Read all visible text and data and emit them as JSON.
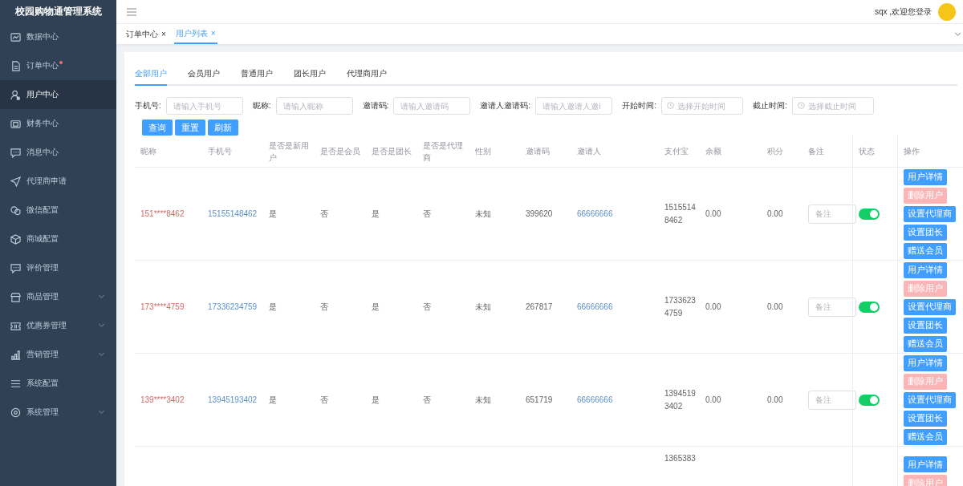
{
  "app": {
    "title": "校园购物通管理系统"
  },
  "sidebar": {
    "items": [
      {
        "label": "数据中心",
        "selected": false,
        "badge": false,
        "expandable": false
      },
      {
        "label": "订单中心",
        "selected": false,
        "badge": true,
        "expandable": false
      },
      {
        "label": "用户中心",
        "selected": true,
        "badge": false,
        "expandable": false
      },
      {
        "label": "财务中心",
        "selected": false,
        "badge": false,
        "expandable": false
      },
      {
        "label": "消息中心",
        "selected": false,
        "badge": false,
        "expandable": false
      },
      {
        "label": "代理商申请",
        "selected": false,
        "badge": false,
        "expandable": false
      },
      {
        "label": "微信配置",
        "selected": false,
        "badge": false,
        "expandable": false
      },
      {
        "label": "商城配置",
        "selected": false,
        "badge": false,
        "expandable": false
      },
      {
        "label": "评价管理",
        "selected": false,
        "badge": false,
        "expandable": false
      },
      {
        "label": "商品管理",
        "selected": false,
        "badge": false,
        "expandable": true
      },
      {
        "label": "优惠券管理",
        "selected": false,
        "badge": false,
        "expandable": true
      },
      {
        "label": "营销管理",
        "selected": false,
        "badge": false,
        "expandable": true
      },
      {
        "label": "系统配置",
        "selected": false,
        "badge": false,
        "expandable": false
      },
      {
        "label": "系统管理",
        "selected": false,
        "badge": false,
        "expandable": true
      }
    ]
  },
  "header": {
    "greeting": "sqx ,欢迎您登录"
  },
  "page_tabs": [
    {
      "label": "订单中心",
      "close": "×",
      "selected": false
    },
    {
      "label": "用户列表",
      "close": "×",
      "selected": true
    }
  ],
  "user_tabs": [
    {
      "label": "全部用户",
      "selected": true
    },
    {
      "label": "会员用户",
      "selected": false
    },
    {
      "label": "普通用户",
      "selected": false
    },
    {
      "label": "团长用户",
      "selected": false
    },
    {
      "label": "代理商用户",
      "selected": false
    }
  ],
  "filters": [
    {
      "label": "手机号:",
      "placeholder": "请输入手机号",
      "kind": "text"
    },
    {
      "label": "昵称:",
      "placeholder": "请输入昵称",
      "kind": "text"
    },
    {
      "label": "邀请码:",
      "placeholder": "请输入邀请码",
      "kind": "text"
    },
    {
      "label": "邀请人邀请码:",
      "placeholder": "请输入邀请人邀i",
      "kind": "text"
    },
    {
      "label": "开始时间:",
      "placeholder": "选择开始时间",
      "kind": "time"
    },
    {
      "label": "截止时间:",
      "placeholder": "选择截止时间",
      "kind": "time"
    }
  ],
  "filter_buttons": [
    "查询",
    "重置",
    "刷新"
  ],
  "table": {
    "columns": [
      "昵称",
      "手机号",
      "是否是新用户",
      "是否是会员",
      "是否是团长",
      "是否是代理商",
      "性别",
      "邀请码",
      "邀请人",
      "支付宝",
      "余额",
      "积分",
      "备注",
      "状态",
      "操作"
    ],
    "rows": [
      {
        "nickname": "151****8462",
        "phone": "15155148462",
        "is_new": "是",
        "is_member": "否",
        "is_leader": "是",
        "is_agent": "否",
        "gender": "未知",
        "invite_code": "399620",
        "inviter": "66666666",
        "alipay": "15155148462",
        "balance": "0.00",
        "points": "0.00",
        "remark_placeholder": "备注",
        "status_on": true,
        "actions": [
          {
            "label": "用户详情",
            "kind": "primary",
            "disabled": false
          },
          {
            "label": "删除用户",
            "kind": "danger",
            "disabled": true
          },
          {
            "label": "设置代理商",
            "kind": "primary",
            "disabled": false
          },
          {
            "label": "设置团长",
            "kind": "primary",
            "disabled": false
          },
          {
            "label": "赠送会员",
            "kind": "primary",
            "disabled": false
          }
        ]
      },
      {
        "nickname": "173****4759",
        "phone": "17336234759",
        "is_new": "是",
        "is_member": "否",
        "is_leader": "是",
        "is_agent": "否",
        "gender": "未知",
        "invite_code": "267817",
        "inviter": "66666666",
        "alipay": "17336234759",
        "balance": "0.00",
        "points": "0.00",
        "remark_placeholder": "备注",
        "status_on": true,
        "actions": [
          {
            "label": "用户详情",
            "kind": "primary",
            "disabled": false
          },
          {
            "label": "删除用户",
            "kind": "danger",
            "disabled": true
          },
          {
            "label": "设置代理商",
            "kind": "primary",
            "disabled": false
          },
          {
            "label": "设置团长",
            "kind": "primary",
            "disabled": false
          },
          {
            "label": "赠送会员",
            "kind": "primary",
            "disabled": false
          }
        ]
      },
      {
        "nickname": "139****3402",
        "phone": "13945193402",
        "is_new": "是",
        "is_member": "否",
        "is_leader": "是",
        "is_agent": "否",
        "gender": "未知",
        "invite_code": "651719",
        "inviter": "66666666",
        "alipay": "13945193402",
        "balance": "0.00",
        "points": "0.00",
        "remark_placeholder": "备注",
        "status_on": true,
        "actions": [
          {
            "label": "用户详情",
            "kind": "primary",
            "disabled": false
          },
          {
            "label": "删除用户",
            "kind": "danger",
            "disabled": true
          },
          {
            "label": "设置代理商",
            "kind": "primary",
            "disabled": false
          },
          {
            "label": "设置团长",
            "kind": "primary",
            "disabled": false
          },
          {
            "label": "赠送会员",
            "kind": "primary",
            "disabled": false
          }
        ]
      },
      {
        "alipay": "1365383",
        "actions": [
          {
            "label": "用户详情",
            "kind": "primary",
            "disabled": false
          },
          {
            "label": "删除用户",
            "kind": "danger",
            "disabled": true
          }
        ]
      }
    ]
  }
}
